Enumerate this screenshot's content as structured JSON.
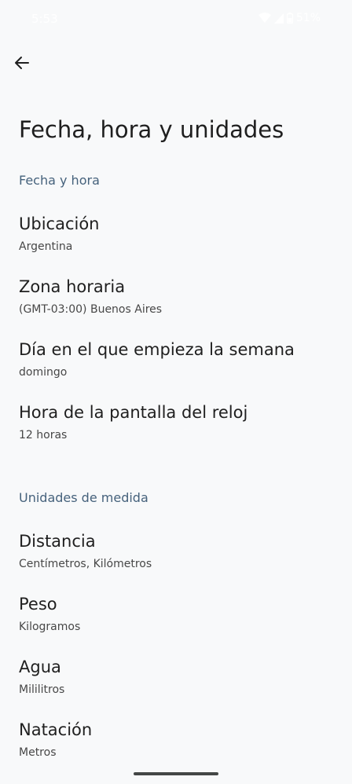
{
  "status_bar": {
    "time": "5:53",
    "battery": "51%",
    "icons": [
      "wifi-icon",
      "signal-icon",
      "battery-icon"
    ]
  },
  "header": {
    "back_icon": "arrow-back-icon",
    "title": "Fecha, hora y unidades"
  },
  "sections": {
    "date_time": {
      "header": "Fecha y hora",
      "items": [
        {
          "title": "Ubicación",
          "summary": "Argentina"
        },
        {
          "title": "Zona horaria",
          "summary": "(GMT-03:00) Buenos Aires"
        },
        {
          "title": "Día en el que empieza la semana",
          "summary": "domingo"
        },
        {
          "title": "Hora de la pantalla del reloj",
          "summary": "12 horas"
        }
      ]
    },
    "units": {
      "header": "Unidades de medida",
      "items": [
        {
          "title": "Distancia",
          "summary": "Centímetros, Kilómetros"
        },
        {
          "title": "Peso",
          "summary": "Kilogramos"
        },
        {
          "title": "Agua",
          "summary": "Mililitros"
        },
        {
          "title": "Natación",
          "summary": "Metros"
        }
      ]
    }
  },
  "colors": {
    "background": "#f8f9fa",
    "section_header": "#46627c",
    "title_text": "#1f1f1f",
    "summary_text": "#474747"
  }
}
